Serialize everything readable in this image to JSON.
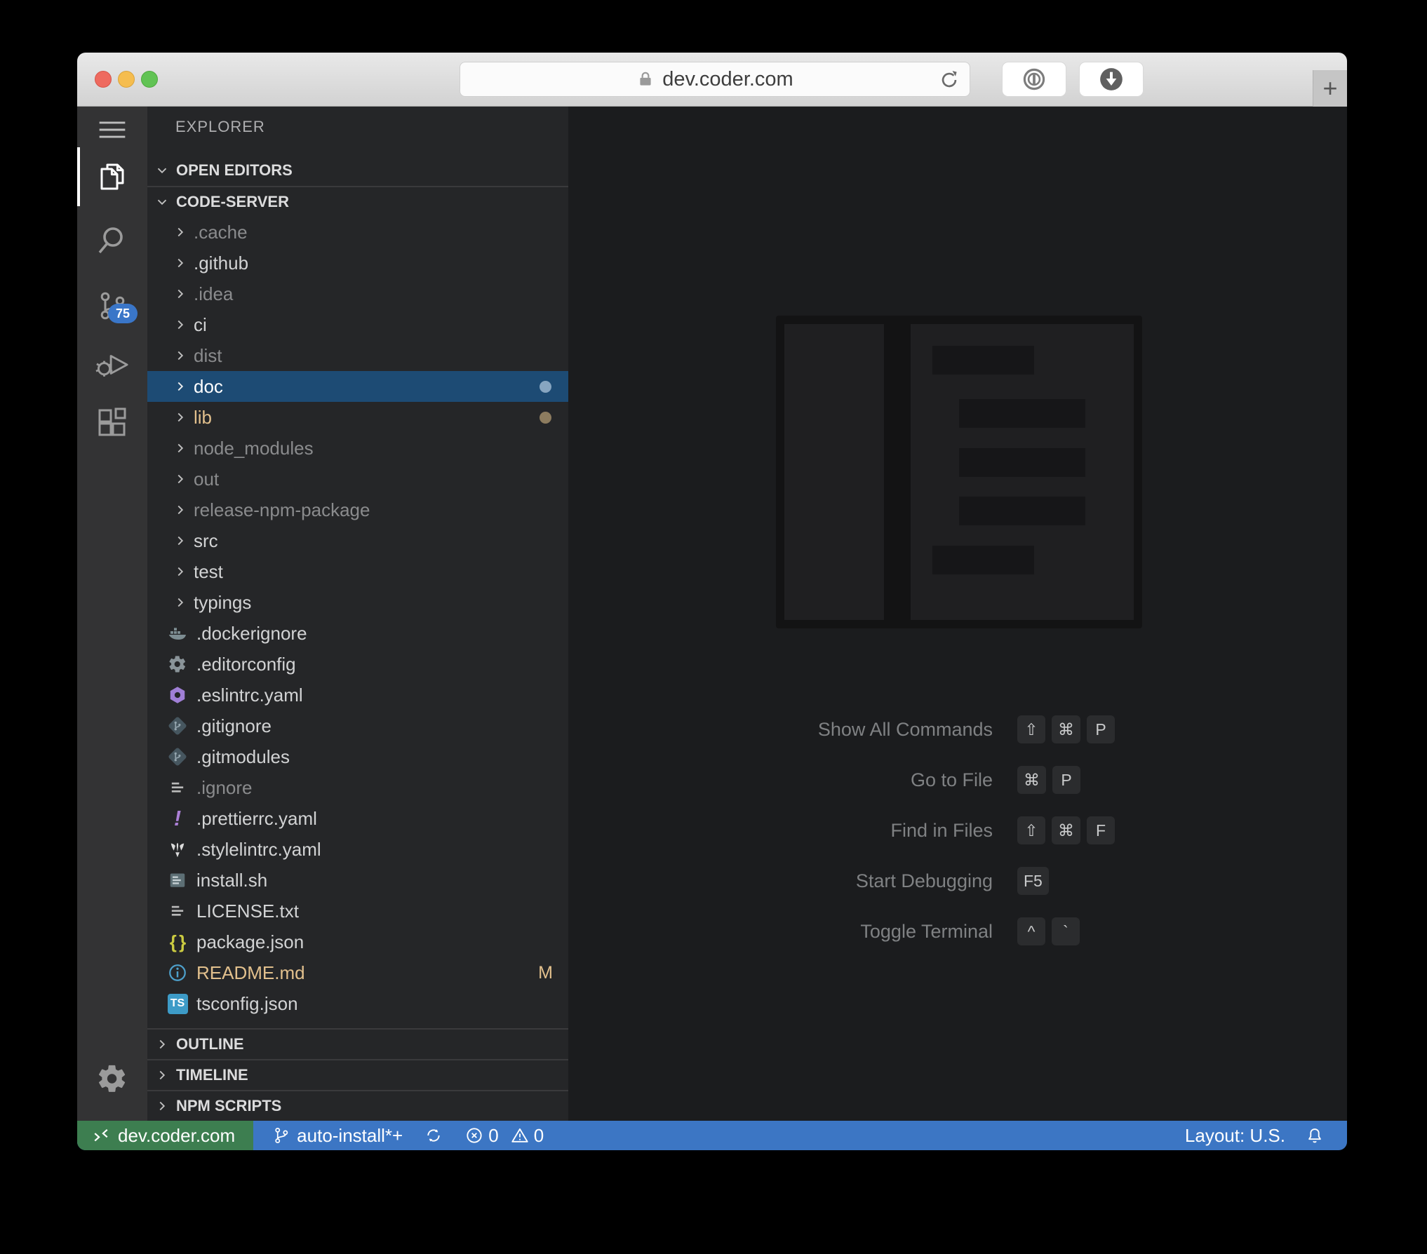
{
  "browser": {
    "url": "dev.coder.com",
    "new_tab_label": "+"
  },
  "vscode": {
    "explorer_title": "EXPLORER",
    "sections": {
      "open_editors": "OPEN EDITORS",
      "workspace": "CODE-SERVER",
      "outline": "OUTLINE",
      "timeline": "TIMELINE",
      "npm_scripts": "NPM SCRIPTS"
    },
    "scm_badge": "75",
    "tree": [
      {
        "name": ".cache",
        "kind": "folder",
        "dim": true
      },
      {
        "name": ".github",
        "kind": "folder"
      },
      {
        "name": ".idea",
        "kind": "folder",
        "dim": true
      },
      {
        "name": "ci",
        "kind": "folder"
      },
      {
        "name": "dist",
        "kind": "folder",
        "dim": true
      },
      {
        "name": "doc",
        "kind": "folder",
        "selected": true,
        "dot": "#87a5c0"
      },
      {
        "name": "lib",
        "kind": "folder",
        "color": "#e2c08d",
        "dot": "#8d7c5f"
      },
      {
        "name": "node_modules",
        "kind": "folder",
        "dim": true
      },
      {
        "name": "out",
        "kind": "folder",
        "dim": true
      },
      {
        "name": "release-npm-package",
        "kind": "folder",
        "dim": true
      },
      {
        "name": "src",
        "kind": "folder"
      },
      {
        "name": "test",
        "kind": "folder"
      },
      {
        "name": "typings",
        "kind": "folder"
      },
      {
        "name": ".dockerignore",
        "kind": "file",
        "icon": "docker"
      },
      {
        "name": ".editorconfig",
        "kind": "file",
        "icon": "gear"
      },
      {
        "name": ".eslintrc.yaml",
        "kind": "file",
        "icon": "eslint"
      },
      {
        "name": ".gitignore",
        "kind": "file",
        "icon": "git"
      },
      {
        "name": ".gitmodules",
        "kind": "file",
        "icon": "git"
      },
      {
        "name": ".ignore",
        "kind": "file",
        "icon": "lines",
        "dim": true
      },
      {
        "name": ".prettierrc.yaml",
        "kind": "file",
        "icon": "prettier"
      },
      {
        "name": ".stylelintrc.yaml",
        "kind": "file",
        "icon": "stylelint"
      },
      {
        "name": "install.sh",
        "kind": "file",
        "icon": "shell"
      },
      {
        "name": "LICENSE.txt",
        "kind": "file",
        "icon": "lines"
      },
      {
        "name": "package.json",
        "kind": "file",
        "icon": "json"
      },
      {
        "name": "README.md",
        "kind": "file",
        "icon": "info",
        "color": "#e2c08d",
        "badge": "M"
      },
      {
        "name": "tsconfig.json",
        "kind": "file",
        "icon": "ts"
      }
    ],
    "shortcuts": [
      {
        "label": "Show All Commands",
        "keys": [
          "⇧",
          "⌘",
          "P"
        ]
      },
      {
        "label": "Go to File",
        "keys": [
          "⌘",
          "P"
        ]
      },
      {
        "label": "Find in Files",
        "keys": [
          "⇧",
          "⌘",
          "F"
        ]
      },
      {
        "label": "Start Debugging",
        "keys": [
          "F5"
        ]
      },
      {
        "label": "Toggle Terminal",
        "keys": [
          "^",
          "`"
        ]
      }
    ],
    "status_bar": {
      "remote": "dev.coder.com",
      "branch": "auto-install*+",
      "errors": "0",
      "warnings": "0",
      "layout": "Layout: U.S."
    }
  },
  "colors": {
    "status_blue": "#3c76c4",
    "remote_green": "#3d7e50",
    "selection_blue": "#1d4b74",
    "git_modified_tan": "#e2c08d",
    "scm_badge_blue": "#3a76c8"
  }
}
